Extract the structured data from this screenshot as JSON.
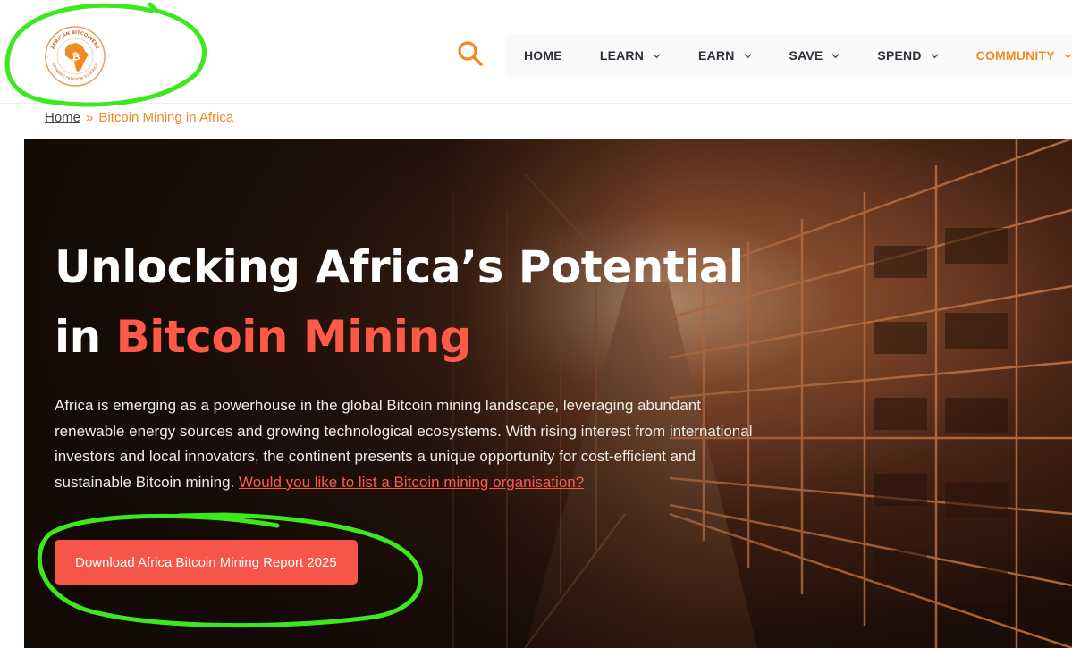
{
  "header": {
    "logo": {
      "ring_text_top": "AFRICAN BITCOINERS",
      "ring_text_bottom": "BRINGING FREEDOM TO AFRICA",
      "symbol": "₿"
    },
    "search_icon": "search-icon",
    "nav": [
      {
        "label": "HOME",
        "dropdown": false,
        "active": false
      },
      {
        "label": "LEARN",
        "dropdown": true,
        "active": false
      },
      {
        "label": "EARN",
        "dropdown": true,
        "active": false
      },
      {
        "label": "SAVE",
        "dropdown": true,
        "active": false
      },
      {
        "label": "SPEND",
        "dropdown": true,
        "active": false
      },
      {
        "label": "COMMUNITY",
        "dropdown": true,
        "active": true
      }
    ]
  },
  "breadcrumb": {
    "home": "Home",
    "separator": "»",
    "current": "Bitcoin Mining in Africa"
  },
  "hero": {
    "title_line1": "Unlocking Africa’s Potential",
    "title_line2_prefix": "in",
    "title_line2_accent": "Bitcoin Mining",
    "description": "Africa is emerging as a powerhouse in the global Bitcoin mining landscape, leveraging abundant renewable energy sources and growing technological ecosystems. With rising interest from international investors and local innovators, the continent presents a unique opportunity for cost-efficient and sustainable Bitcoin mining.",
    "link_text": "Would you like to list a Bitcoin mining organisation?",
    "cta_label": "Download Africa Bitcoin Mining Report 2025"
  },
  "colors": {
    "accent_orange": "#f08a24",
    "accent_red": "#ff5a48",
    "cta_bg": "#f6564a",
    "annotation_green": "#3ee81e"
  }
}
